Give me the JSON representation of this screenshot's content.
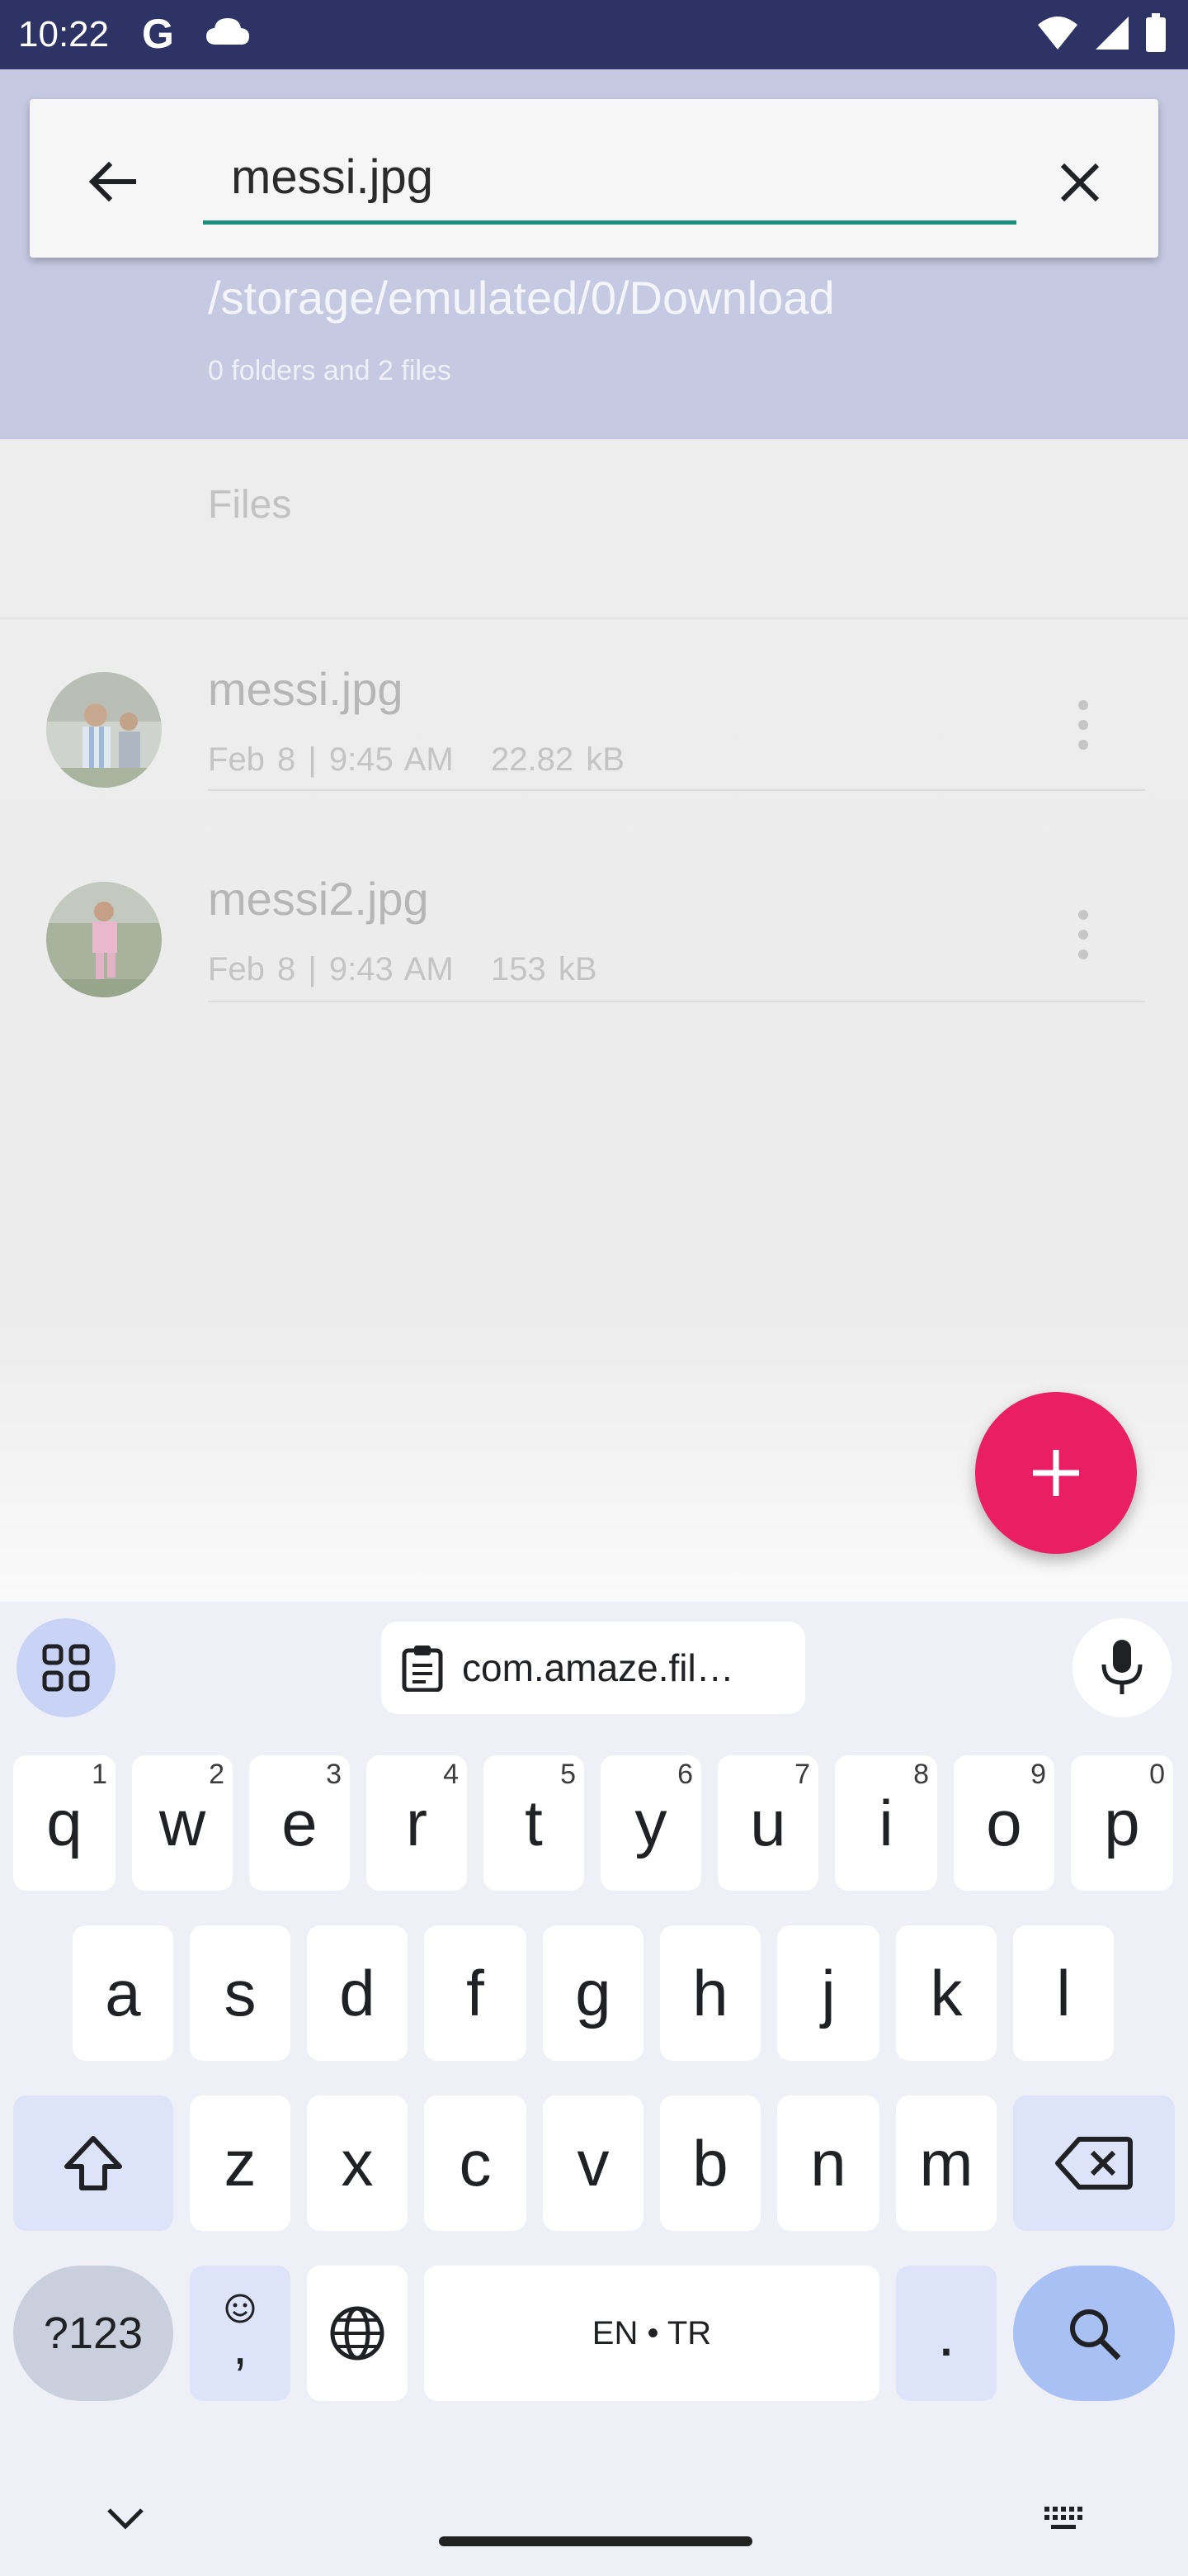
{
  "status_bar": {
    "time": "10:22",
    "google_letter": "G",
    "icons": [
      "google-icon",
      "cloud-icon",
      "wifi-icon",
      "signal-icon",
      "battery-icon"
    ]
  },
  "search": {
    "query": "messi.jpg",
    "back_icon": "arrow-left-icon",
    "clear_icon": "close-icon"
  },
  "directory": {
    "path": "/storage/emulated/0/Download",
    "summary": "0 folders and 2 files"
  },
  "list": {
    "section_title": "Files",
    "items": [
      {
        "name": "messi.jpg",
        "date": "Feb 8 | 9:45 AM",
        "size": "22.82 kB"
      },
      {
        "name": "messi2.jpg",
        "date": "Feb 8 | 9:43 AM",
        "size": "153 kB"
      }
    ]
  },
  "fab": {
    "icon": "plus-icon"
  },
  "keyboard": {
    "clipboard_chip": "com.amaze.fil…",
    "row1": [
      {
        "k": "q",
        "h": "1"
      },
      {
        "k": "w",
        "h": "2"
      },
      {
        "k": "e",
        "h": "3"
      },
      {
        "k": "r",
        "h": "4"
      },
      {
        "k": "t",
        "h": "5"
      },
      {
        "k": "y",
        "h": "6"
      },
      {
        "k": "u",
        "h": "7"
      },
      {
        "k": "i",
        "h": "8"
      },
      {
        "k": "o",
        "h": "9"
      },
      {
        "k": "p",
        "h": "0"
      }
    ],
    "row2": [
      "a",
      "s",
      "d",
      "f",
      "g",
      "h",
      "j",
      "k",
      "l"
    ],
    "row3": [
      "z",
      "x",
      "c",
      "v",
      "b",
      "n",
      "m"
    ],
    "symbols_label": "?123",
    "emoji_comma": ",",
    "space_label": "EN • TR",
    "period": "."
  },
  "colors": {
    "status_bar": "#2e3366",
    "app_bar_dimmed": "#c5c9e2",
    "accent_teal": "#1b8f80",
    "fab": "#e91e63",
    "keyboard_bg": "#efeff7",
    "keyboard_special": "#dde3f8"
  }
}
